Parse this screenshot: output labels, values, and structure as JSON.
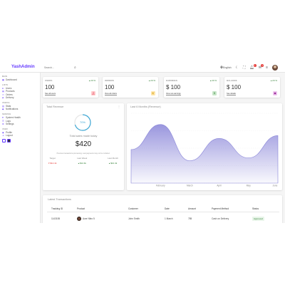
{
  "app": {
    "logo": "YashAdmin"
  },
  "search": {
    "placeholder": "Search..."
  },
  "navbar": {
    "language": "English",
    "notifications_count": "1",
    "messages_count": "2"
  },
  "sidebar": {
    "sections": [
      {
        "title": "MAIN",
        "items": [
          {
            "label": "Dashboard",
            "icon": "dashboard-icon"
          }
        ]
      },
      {
        "title": "LISTS",
        "items": [
          {
            "label": "Users",
            "icon": "user-icon"
          },
          {
            "label": "Products",
            "icon": "store-icon"
          },
          {
            "label": "Orders",
            "icon": "card-icon"
          },
          {
            "label": "Delivery",
            "icon": "truck-icon"
          }
        ]
      },
      {
        "title": "USEFUL",
        "items": [
          {
            "label": "Stats",
            "icon": "chart-icon"
          },
          {
            "label": "Notifications",
            "icon": "bell-icon"
          }
        ]
      },
      {
        "title": "SERVICE",
        "items": [
          {
            "label": "System Health",
            "icon": "health-icon"
          },
          {
            "label": "Logs",
            "icon": "logs-icon"
          },
          {
            "label": "Settings",
            "icon": "gear-icon"
          }
        ]
      },
      {
        "title": "USER",
        "items": [
          {
            "label": "Profile",
            "icon": "profile-icon"
          },
          {
            "label": "Logout",
            "icon": "logout-icon"
          }
        ]
      }
    ],
    "theme_colors": [
      "#f3f3ff",
      "#333333"
    ]
  },
  "widgets": [
    {
      "title": "USERS",
      "value": "100",
      "pct": "20 %",
      "link": "See all users",
      "icon": "person-icon",
      "icon_color": "#dc143c",
      "icon_bg": "#ffcccc"
    },
    {
      "title": "ORDERS",
      "value": "100",
      "pct": "20 %",
      "link": "View all orders",
      "icon": "cart-icon",
      "icon_color": "#daa520",
      "icon_bg": "#ffe8b0"
    },
    {
      "title": "EARNINGS",
      "value": "$ 100",
      "pct": "20 %",
      "link": "View net earnings",
      "icon": "dollar-icon",
      "icon_color": "#2e7d32",
      "icon_bg": "#c8e6c9"
    },
    {
      "title": "BALANCE",
      "value": "$ 100",
      "pct": "20 %",
      "link": "See details",
      "icon": "wallet-icon",
      "icon_color": "#800080",
      "icon_bg": "#f0c8f0"
    }
  ],
  "featured": {
    "title": "Total Revenue",
    "progress_pct": 70,
    "progress_label": "70%",
    "subtitle": "Total sales made today",
    "amount": "$420",
    "description": "Previous transactions processing. Last payments may not be included.",
    "summary": [
      {
        "title": "Target",
        "value": "▾ $12.4k",
        "color": "#e53935"
      },
      {
        "title": "Last Week",
        "value": "▴ $12.4k",
        "color": "#2e7d32"
      },
      {
        "title": "Last Month",
        "value": "▴ $12.4k",
        "color": "#2e7d32"
      }
    ]
  },
  "chart_data": {
    "type": "area",
    "title": "Last 6 Months (Revenue)",
    "categories": [
      "January",
      "February",
      "March",
      "April",
      "May",
      "June"
    ],
    "values": [
      1200,
      2100,
      800,
      1600,
      900,
      1700
    ],
    "ylim": [
      0,
      2500
    ],
    "color": "#8884d8",
    "grid": true,
    "legend": "none"
  },
  "table": {
    "title": "Latest Transactions",
    "headers": [
      "Tracking ID",
      "Product",
      "Customer",
      "Date",
      "Amount",
      "Payment Method",
      "Status"
    ],
    "rows": [
      [
        "1143155",
        "Acer Nitro 5",
        "John Smith",
        "1 March",
        "785",
        "Cash on Delivery",
        "Approved"
      ]
    ]
  }
}
